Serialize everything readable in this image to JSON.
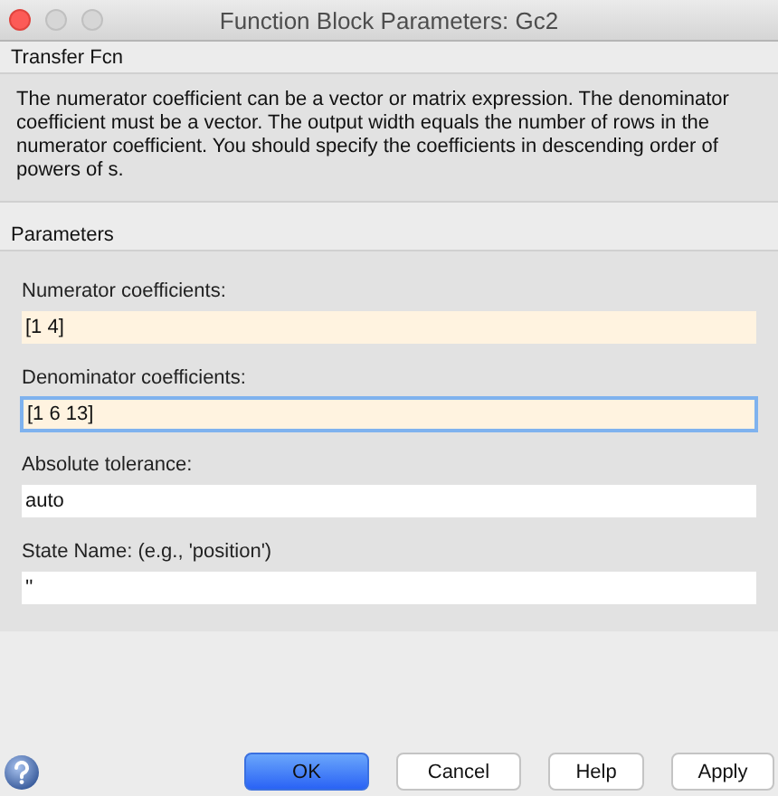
{
  "window": {
    "title": "Function Block Parameters: Gc2"
  },
  "block_type": "Transfer Fcn",
  "description": "The numerator coefficient can be a vector or matrix expression. The denominator coefficient must be a vector. The output width equals the number of rows in the numerator coefficient. You should specify the coefficients in descending order of powers of s.",
  "parameters": {
    "heading": "Parameters",
    "fields": [
      {
        "label": "Numerator coefficients:",
        "value": "[1 4]",
        "modified": true,
        "focused": false
      },
      {
        "label": "Denominator coefficients:",
        "value": "[1 6 13]",
        "modified": true,
        "focused": true
      },
      {
        "label": "Absolute tolerance:",
        "value": "auto",
        "modified": false,
        "focused": false
      },
      {
        "label": "State Name: (e.g., 'position')",
        "value": "''",
        "modified": false,
        "focused": false
      }
    ]
  },
  "buttons": [
    {
      "label": "OK",
      "default": true
    },
    {
      "label": "Cancel",
      "default": false
    },
    {
      "label": "Help",
      "default": false
    },
    {
      "label": "Apply",
      "default": false
    }
  ]
}
